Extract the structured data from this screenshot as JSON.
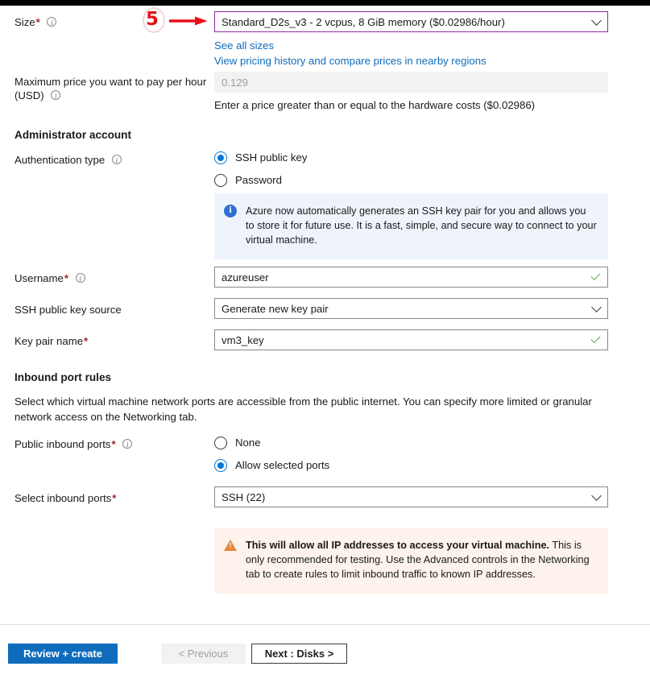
{
  "size_row": {
    "label": "Size",
    "required": true,
    "has_info_icon": true,
    "value": "Standard_D2s_v3 - 2 vcpus, 8 GiB memory ($0.02986/hour)",
    "dropdown_icon": "chevron-down-icon",
    "focused": true,
    "links": [
      "See all sizes",
      "View pricing history and compare prices in nearby regions"
    ]
  },
  "annotation": {
    "number": "5",
    "color": "#e8101b",
    "arrow_icon": "right-arrow-icon"
  },
  "max_price_row": {
    "label_line1": "Maximum price you want to pay per hour",
    "label_line2": "(USD)",
    "has_info_icon": true,
    "placeholder": "0.129",
    "value": "",
    "disabled": true,
    "hint": "Enter a price greater than or equal to the hardware costs ($0.02986)"
  },
  "administrator_account": {
    "title": "Administrator account",
    "auth_type": {
      "label": "Authentication type",
      "has_info_icon": true,
      "options": [
        {
          "label": "SSH public key",
          "selected": true
        },
        {
          "label": "Password",
          "selected": false
        }
      ]
    },
    "info_box": {
      "icon": "info-circle-icon",
      "text": "Azure now automatically generates an SSH key pair for you and allows you to store it for future use. It is a fast, simple, and secure way to connect to your virtual machine.",
      "background": "#eff4fc"
    },
    "username": {
      "label": "Username",
      "required": true,
      "has_info_icon": true,
      "value": "azureuser",
      "valid_icon": "checkmark-icon"
    },
    "ssh_key_source": {
      "label": "SSH public key source",
      "required": false,
      "value": "Generate new key pair",
      "dropdown_icon": "chevron-down-icon"
    },
    "key_pair_name": {
      "label": "Key pair name",
      "required": true,
      "value": "vm3_key",
      "valid_icon": "checkmark-icon"
    }
  },
  "inbound_port_rules": {
    "title": "Inbound port rules",
    "description": "Select which virtual machine network ports are accessible from the public internet. You can specify more limited or granular network access on the Networking tab.",
    "public_inbound_ports": {
      "label": "Public inbound ports",
      "required": true,
      "has_info_icon": true,
      "options": [
        {
          "label": "None",
          "selected": false
        },
        {
          "label": "Allow selected ports",
          "selected": true
        }
      ]
    },
    "select_inbound_ports": {
      "label": "Select inbound ports",
      "required": true,
      "value": "SSH (22)",
      "dropdown_icon": "chevron-down-icon"
    },
    "warning_box": {
      "icon": "warning-triangle-icon",
      "bold_text": "This will allow all IP addresses to access your virtual machine.",
      "text": " This is only recommended for testing.  Use the Advanced controls in the Networking tab to create rules to limit inbound traffic to known IP addresses.",
      "background": "#fdf3ec"
    }
  },
  "footer": {
    "review_create": "Review + create",
    "previous": "< Previous",
    "previous_disabled": true,
    "next": "Next : Disks >"
  },
  "colors": {
    "accent": "#0f6cbd",
    "link": "#0f6cbd",
    "required_star": "#a4262c",
    "focus_border": "#8f2aa0",
    "valid_check": "#6aa84f",
    "annotation_red": "#e8101b"
  }
}
